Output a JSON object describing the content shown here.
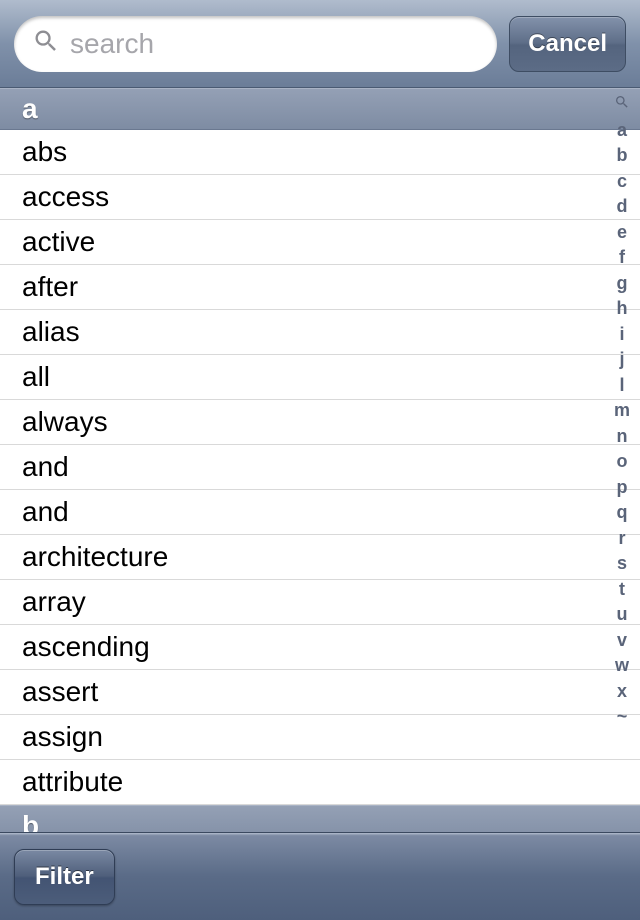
{
  "search": {
    "placeholder": "search",
    "value": "",
    "cancel_label": "Cancel"
  },
  "sections": [
    {
      "letter": "a",
      "items": [
        "abs",
        "access",
        "active",
        "after",
        "alias",
        "all",
        "always",
        "and",
        "and",
        "architecture",
        "array",
        "ascending",
        "assert",
        "assign",
        "attribute"
      ]
    },
    {
      "letter": "b",
      "items": []
    }
  ],
  "index_letters": [
    "a",
    "b",
    "c",
    "d",
    "e",
    "f",
    "g",
    "h",
    "i",
    "j",
    "l",
    "m",
    "n",
    "o",
    "p",
    "q",
    "r",
    "s",
    "t",
    "u",
    "v",
    "w",
    "x",
    "~"
  ],
  "toolbar": {
    "filter_label": "Filter"
  }
}
